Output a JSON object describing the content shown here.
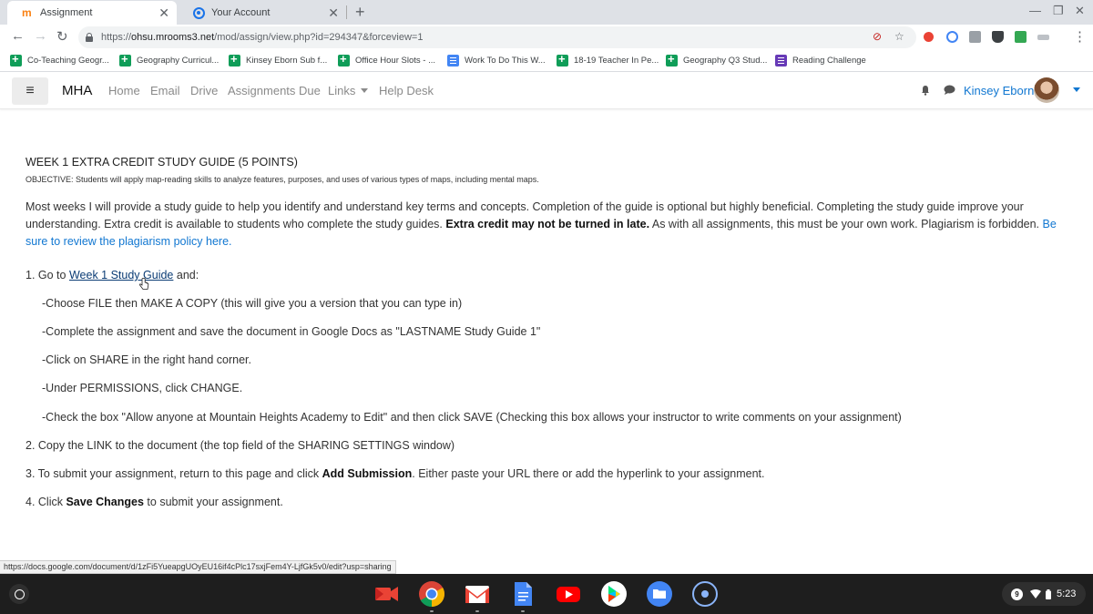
{
  "browser": {
    "tabs": [
      {
        "title": "Assignment",
        "active": true
      },
      {
        "title": "Your Account",
        "active": false
      }
    ],
    "new_tab_label": "+",
    "close_glyph": "✕",
    "url_scheme": "https://",
    "url_host": "ohsu.mrooms3.net",
    "url_path": "/mod/assign/view.php?id=294347&forceview=1",
    "bookmarks": [
      {
        "label": "Co-Teaching Geogr...",
        "icon": "sheets-icon"
      },
      {
        "label": "Geography Curricul...",
        "icon": "sheets-icon"
      },
      {
        "label": "Kinsey Eborn Sub f...",
        "icon": "sheets-icon"
      },
      {
        "label": "Office Hour Slots - ...",
        "icon": "sheets-icon"
      },
      {
        "label": "Work To Do This W...",
        "icon": "docs-icon"
      },
      {
        "label": "18-19 Teacher In Pe...",
        "icon": "sheets-icon"
      },
      {
        "label": "Geography Q3 Stud...",
        "icon": "sheets-icon"
      },
      {
        "label": "Reading Challenge",
        "icon": "forms-icon"
      }
    ]
  },
  "site": {
    "brand": "MHA",
    "menu": [
      "Home",
      "Email",
      "Drive",
      "Assignments Due",
      "Links",
      "Help Desk"
    ],
    "user_name": "Kinsey Eborn"
  },
  "assignment": {
    "title": "WEEK 1 EXTRA CREDIT STUDY GUIDE (5 POINTS)",
    "objective": "OBJECTIVE: Students will apply map-reading skills to analyze features, purposes, and uses of various types of maps, including mental maps.",
    "intro_text": "Most weeks I will provide a study guide to help you identify and understand key terms and concepts. Completion of the guide is optional but highly beneficial. Completing the study guide improve your understanding. Extra credit is available to students who complete the study guides.",
    "intro_bold": "Extra credit may not be turned in late.",
    "intro_tail": "As with all assignments, this must be your own work. Plagiarism is forbidden.",
    "intro_link": "Be sure to review the plagiarism policy here.",
    "step1_prefix": "1. Go to",
    "step1_link": "Week 1 Study Guide",
    "step1_suffix": "and:",
    "substeps": [
      "-Choose FILE then MAKE A COPY  (this will give you a version that you can type in)",
      "-Complete the assignment and save the document in Google Docs as \"LASTNAME Study Guide 1\"",
      "-Click on SHARE in the right hand corner.",
      "-Under PERMISSIONS, click CHANGE.",
      "-Check the box \"Allow anyone at Mountain Heights Academy to Edit\" and then click SAVE (Checking this box allows your instructor to write comments on your assignment)"
    ],
    "step2": "2. Copy the LINK to the document (the top field of the SHARING SETTINGS window)",
    "step3_prefix": "3.  To submit your assignment, return to this page and click",
    "step3_bold": "Add Submission",
    "step3_suffix": ". Either paste your URL there or add the hyperlink to your assignment.",
    "step4_prefix": "4.  Click",
    "step4_bold": "Save Changes",
    "step4_suffix": "to submit your assignment."
  },
  "status_url": "https://docs.google.com/document/d/1zFi5YueapgUOyEU16if4cPlc17sxjFem4Y-LjfGk5v0/edit?usp=sharing",
  "shelf": {
    "apps": [
      "screencast-icon",
      "chrome-icon",
      "gmail-icon",
      "docs-icon",
      "youtube-icon",
      "play-store-icon",
      "files-icon",
      "assistant-icon"
    ],
    "notification_count": "9",
    "time": "5:23"
  },
  "colors": {
    "link": "#1177d1",
    "tabstrip": "#dee1e6",
    "shelf": "#1e1e1e"
  }
}
